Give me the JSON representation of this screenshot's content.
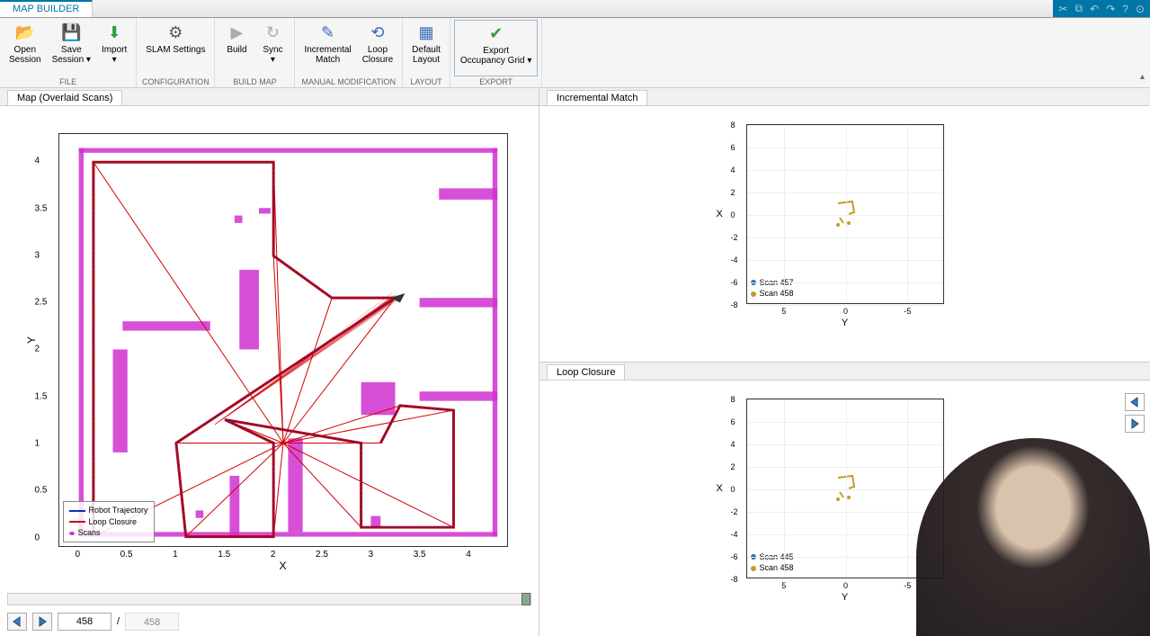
{
  "app_tab": "MAP BUILDER",
  "ribbon": {
    "groups": [
      {
        "label": "FILE",
        "items": [
          {
            "name": "open-session",
            "icon": "📂",
            "text": "Open\nSession",
            "color": "#d4a040"
          },
          {
            "name": "save-session",
            "icon": "💾",
            "text": "Save\nSession ▾",
            "color": "#555"
          },
          {
            "name": "import",
            "icon": "⬇",
            "text": "Import\n▾",
            "color": "#3a9c3a"
          }
        ]
      },
      {
        "label": "CONFIGURATION",
        "items": [
          {
            "name": "slam-settings",
            "icon": "⚙",
            "text": "SLAM Settings",
            "color": "#555"
          }
        ]
      },
      {
        "label": "BUILD MAP",
        "items": [
          {
            "name": "build",
            "icon": "▶",
            "text": "Build",
            "color": "#aaa"
          },
          {
            "name": "sync",
            "icon": "↻",
            "text": "Sync\n▾",
            "color": "#aaa"
          }
        ]
      },
      {
        "label": "MANUAL MODIFICATION",
        "items": [
          {
            "name": "incremental-match",
            "icon": "✎",
            "text": "Incremental\nMatch",
            "color": "#3a6db5"
          },
          {
            "name": "loop-closure",
            "icon": "⟲",
            "text": "Loop\nClosure",
            "color": "#3a6db5"
          }
        ]
      },
      {
        "label": "LAYOUT",
        "items": [
          {
            "name": "default-layout",
            "icon": "▦",
            "text": "Default\nLayout",
            "color": "#3a6db5"
          }
        ]
      },
      {
        "label": "EXPORT",
        "items": [
          {
            "name": "export-occupancy",
            "icon": "✔",
            "text": "Export\nOccupancy Grid ▾",
            "color": "#3a9c3a",
            "highlight": true
          }
        ]
      }
    ]
  },
  "map_tab": "Map (Overlaid Scans)",
  "chart_data": [
    {
      "name": "map-overlaid-scans",
      "type": "scatter",
      "xlabel": "X",
      "ylabel": "Y",
      "xlim": [
        -0.2,
        4.4
      ],
      "ylim": [
        -0.1,
        4.3
      ],
      "xticks": [
        0,
        0.5,
        1,
        1.5,
        2,
        2.5,
        3,
        3.5,
        4
      ],
      "yticks": [
        0,
        0.5,
        1,
        1.5,
        2,
        2.5,
        3,
        3.5,
        4
      ],
      "legend": [
        "Robot Trajectory",
        "Loop Closure",
        "Scans"
      ],
      "colors": {
        "trajectory": "#0030c0",
        "loopclosure": "#d00000",
        "scans": "#d030d0"
      },
      "trajectory": [
        [
          0.15,
          0.0
        ],
        [
          0.15,
          4.0
        ],
        [
          2.0,
          4.0
        ],
        [
          2.0,
          3.0
        ],
        [
          2.6,
          2.55
        ],
        [
          3.25,
          2.55
        ],
        [
          1.0,
          1.0
        ],
        [
          1.1,
          0.0
        ],
        [
          2.0,
          0.0
        ],
        [
          2.0,
          1.0
        ],
        [
          1.5,
          1.25
        ],
        [
          2.9,
          1.0
        ],
        [
          2.9,
          0.1
        ],
        [
          3.85,
          0.1
        ],
        [
          3.85,
          1.35
        ],
        [
          3.3,
          1.4
        ],
        [
          3.1,
          1.0
        ]
      ],
      "scans_note": "Magenta lidar points form room walls & obstacles (approximate rectangles)",
      "scan_rects": [
        [
          0.0,
          0.0,
          4.3,
          0.05
        ],
        [
          0.0,
          4.1,
          4.3,
          0.05
        ],
        [
          0.0,
          0.0,
          0.05,
          4.15
        ],
        [
          4.25,
          0.0,
          0.05,
          4.15
        ],
        [
          0.45,
          2.2,
          0.9,
          0.1
        ],
        [
          0.35,
          0.9,
          0.15,
          1.1
        ],
        [
          1.65,
          2.0,
          0.2,
          0.85
        ],
        [
          1.6,
          3.35,
          0.08,
          0.08
        ],
        [
          1.85,
          3.45,
          0.12,
          0.06
        ],
        [
          1.2,
          0.2,
          0.08,
          0.08
        ],
        [
          1.55,
          0.0,
          0.1,
          0.65
        ],
        [
          2.15,
          0.05,
          0.15,
          1.0
        ],
        [
          3.0,
          0.1,
          0.1,
          0.12
        ],
        [
          2.9,
          1.3,
          0.35,
          0.35
        ],
        [
          3.5,
          1.45,
          0.8,
          0.1
        ],
        [
          3.5,
          2.45,
          0.8,
          0.1
        ],
        [
          3.7,
          3.6,
          0.6,
          0.12
        ]
      ]
    },
    {
      "name": "incremental-match",
      "type": "scatter",
      "xlabel": "Y",
      "ylabel": "X",
      "xlim": [
        -8,
        8
      ],
      "ylim": [
        -8,
        8
      ],
      "xticks": [
        5,
        0,
        -5
      ],
      "yticks": [
        -8,
        -6,
        -4,
        -2,
        0,
        2,
        4,
        6,
        8
      ],
      "series": [
        {
          "name": "Scan 457",
          "color": "#2a6fb0"
        },
        {
          "name": "Scan 458",
          "color": "#c69a2a"
        }
      ]
    },
    {
      "name": "loop-closure",
      "type": "scatter",
      "xlabel": "Y",
      "ylabel": "X",
      "xlim": [
        -8,
        8
      ],
      "ylim": [
        -8,
        8
      ],
      "xticks": [
        5,
        0,
        -5
      ],
      "yticks": [
        -8,
        -6,
        -4,
        -2,
        0,
        2,
        4,
        6,
        8
      ],
      "series": [
        {
          "name": "Scan 445",
          "color": "#2a6fb0"
        },
        {
          "name": "Scan 458",
          "color": "#c69a2a"
        }
      ]
    }
  ],
  "incremental_tab": "Incremental Match",
  "loopclosure_tab": "Loop Closure",
  "frame": {
    "current": "458",
    "total": "458",
    "sep": "/"
  }
}
